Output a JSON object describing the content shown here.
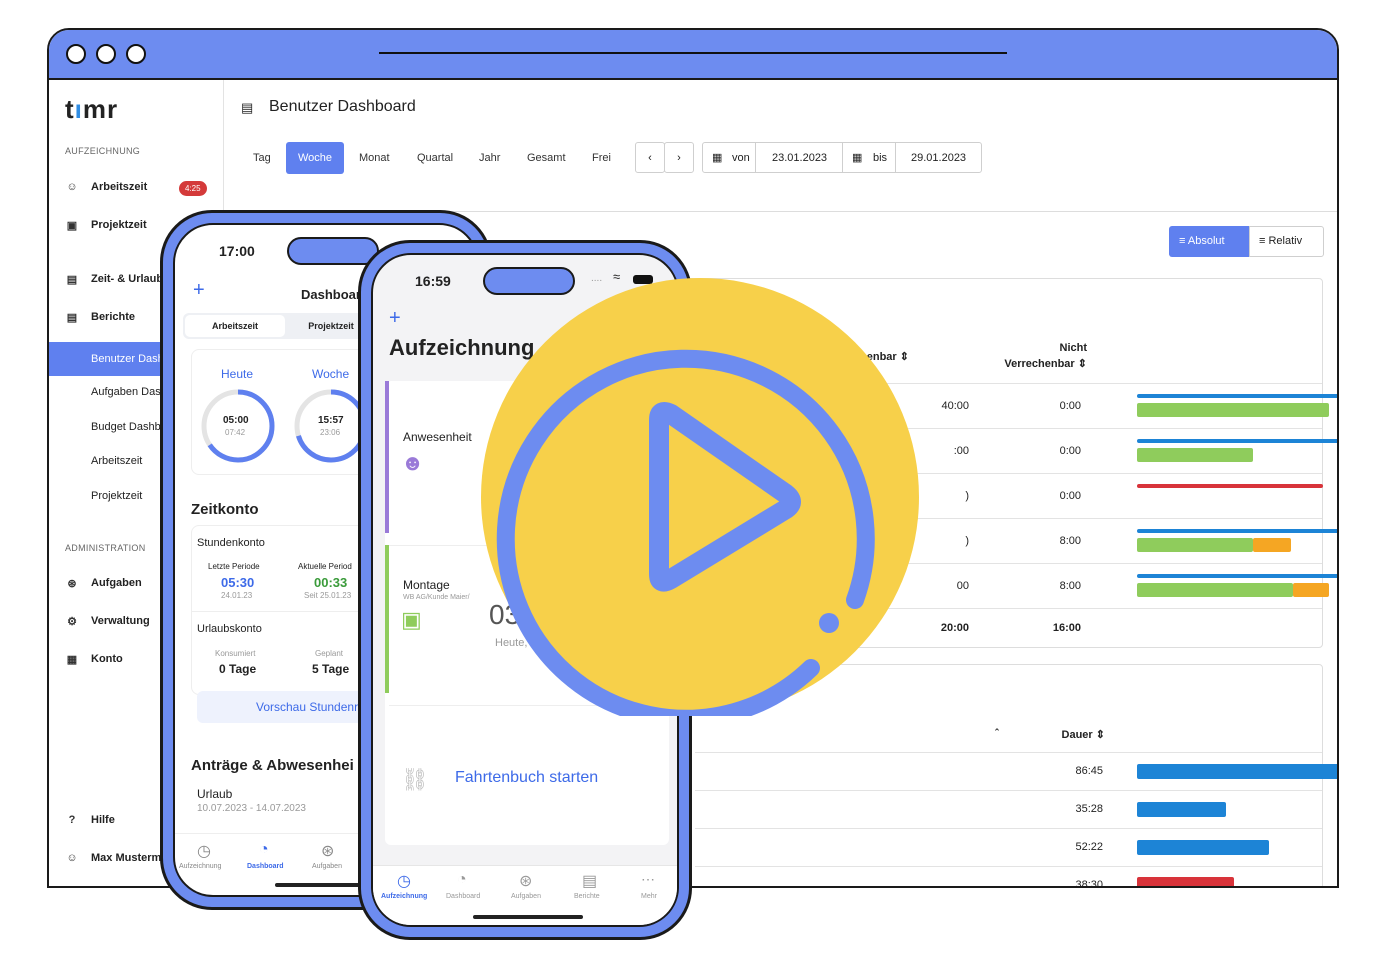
{
  "colors": {
    "brand": "#6d8cf0",
    "accent": "#5f80ef",
    "blue_bar": "#1d84d6",
    "green_bar": "#8fcc5c",
    "orange_bar": "#f5a623",
    "red_bar": "#d8333a",
    "play_bg": "#f7d04a"
  },
  "sidebar": {
    "logo": "timr",
    "section_recording": "AUFZEICHNUNG",
    "items": [
      {
        "label": "Arbeitszeit",
        "icon": "user-clock-icon",
        "badge": "4:25"
      },
      {
        "label": "Projektzeit",
        "icon": "briefcase-clock-icon"
      },
      {
        "label": "Zeit- & Urlaubs",
        "icon": "document-icon"
      },
      {
        "label": "Berichte",
        "icon": "report-icon"
      }
    ],
    "reports": [
      "Benutzer Dash",
      "Aufgaben Das",
      "Budget Dashb",
      "Arbeitszeit",
      "Projektzeit"
    ],
    "section_admin": "ADMINISTRATION",
    "admin": [
      {
        "label": "Aufgaben",
        "icon": "hierarchy-icon"
      },
      {
        "label": "Verwaltung",
        "icon": "gear-icon"
      },
      {
        "label": "Konto",
        "icon": "card-icon"
      }
    ],
    "help": "Hilfe",
    "user": "Max Musterm"
  },
  "header": {
    "title": "Benutzer Dashboard",
    "title_icon": "dashboard-doc-icon"
  },
  "period_tabs": [
    "Tag",
    "Woche",
    "Monat",
    "Quartal",
    "Jahr",
    "Gesamt",
    "Frei"
  ],
  "active_tab": "Woche",
  "date_range": {
    "from_label": "von",
    "from": "23.01.2023",
    "to_label": "bis",
    "to": "29.01.2023"
  },
  "view_toggle": {
    "absolute": "Absolut",
    "relative": "Relativ"
  },
  "table1": {
    "col_billable": "Verrechenbar",
    "col_nonbillable_1": "Nicht",
    "col_nonbillable_2": "Verrechenbar",
    "billable": [
      "40:00",
      ":00",
      ")",
      ")",
      "00",
      "20:00"
    ],
    "nonbillable": [
      "0:00",
      "0:00",
      "0:00",
      "8:00",
      "8:00",
      "16:00"
    ]
  },
  "table2": {
    "col_duration": "Dauer",
    "durations": [
      "86:45",
      "35:28",
      "52:22",
      "38:30"
    ]
  },
  "phone1": {
    "time": "17:00",
    "title": "Dashboard",
    "seg": [
      "Arbeitszeit",
      "Projektzeit"
    ],
    "today_label": "Heute",
    "today_value": "05:00",
    "today_sub": "07:42",
    "week_label": "Woche",
    "week_value": "15:57",
    "week_sub": "23:06",
    "section_account": "Zeitkonto",
    "hours_account": "Stundenkonto",
    "last_period_label": "Letzte Periode",
    "last_period_value": "05:30",
    "last_period_date": "24.01.23",
    "current_period_label": "Aktuelle Period",
    "current_period_value": "00:33",
    "current_period_date": "Seit 25.01.23",
    "vacation_account": "Urlaubskonto",
    "consumed_label": "Konsumiert",
    "consumed_value": "0 Tage",
    "planned_label": "Geplant",
    "planned_value": "5 Tage",
    "preview_button": "Vorschau Stundenr",
    "section_requests": "Anträge & Abwesenhei",
    "request_type": "Urlaub",
    "request_dates": "10.07.2023 - 14.07.2023",
    "nav": [
      "Aufzeichnung",
      "Dashboard",
      "Aufgaben"
    ]
  },
  "phone2": {
    "time": "16:59",
    "status": "....",
    "title": "Aufzeichnung",
    "attendance": "Anwesenheit",
    "assembly": "Montage",
    "assembly_sub": "WB AG/Kunde Maier/",
    "timer": "03",
    "timer_sub": "Heute, 1",
    "logbook": "Fahrtenbuch starten",
    "nav": [
      "Aufzeichnung",
      "Dashboard",
      "Aufgaben",
      "Berichte",
      "Mehr"
    ]
  }
}
